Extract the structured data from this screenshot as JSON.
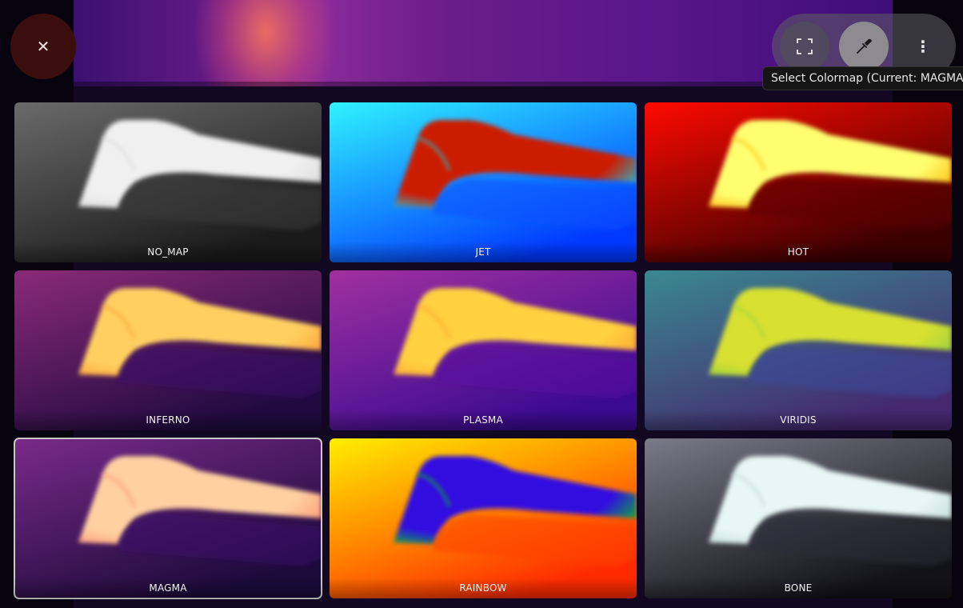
{
  "toolbar": {
    "close_glyph": "✕",
    "more_glyph": "⋮",
    "tooltip": "Select Colormap (Current: MAGMA)"
  },
  "colormaps": [
    {
      "label": "NO_MAP",
      "bg0": "#6a6a6a",
      "bg1": "#1a1a1a",
      "shape": "#f0f0f0",
      "edge": "#d8d8d8",
      "dark": "#3a3a3a",
      "selected": false
    },
    {
      "label": "JET",
      "bg0": "#2ff3ff",
      "bg1": "#0038ff",
      "shape": "#cc1a00",
      "edge": "#00e0ff",
      "dark": "#0a50ff",
      "selected": false
    },
    {
      "label": "HOT",
      "bg0": "#ff0a00",
      "bg1": "#3a0000",
      "shape": "#ffff70",
      "edge": "#ffb000",
      "dark": "#5a0000",
      "selected": false
    },
    {
      "label": "INFERNO",
      "bg0": "#8a2a78",
      "bg1": "#200a40",
      "shape": "#ffd060",
      "edge": "#ff9a30",
      "dark": "#3a0a6a",
      "selected": false
    },
    {
      "label": "PLASMA",
      "bg0": "#a030a0",
      "bg1": "#3a0a90",
      "shape": "#ffd040",
      "edge": "#ffa030",
      "dark": "#5a10a0",
      "selected": false
    },
    {
      "label": "VIRIDIS",
      "bg0": "#3a8890",
      "bg1": "#452870",
      "shape": "#d8e030",
      "edge": "#90d040",
      "dark": "#3a4a9a",
      "selected": false
    },
    {
      "label": "MAGMA",
      "bg0": "#7a2a8a",
      "bg1": "#1c0a3a",
      "shape": "#ffd0a0",
      "edge": "#ff9070",
      "dark": "#3a0a6a",
      "selected": true
    },
    {
      "label": "RAINBOW",
      "bg0": "#ffee00",
      "bg1": "#ff2a00",
      "shape": "#3010e0",
      "edge": "#00e000",
      "dark": "#ff4000",
      "selected": false
    },
    {
      "label": "BONE",
      "bg0": "#7a7a88",
      "bg1": "#121218",
      "shape": "#e8f6f6",
      "edge": "#c0d8d8",
      "dark": "#2a2a38",
      "selected": false
    }
  ]
}
